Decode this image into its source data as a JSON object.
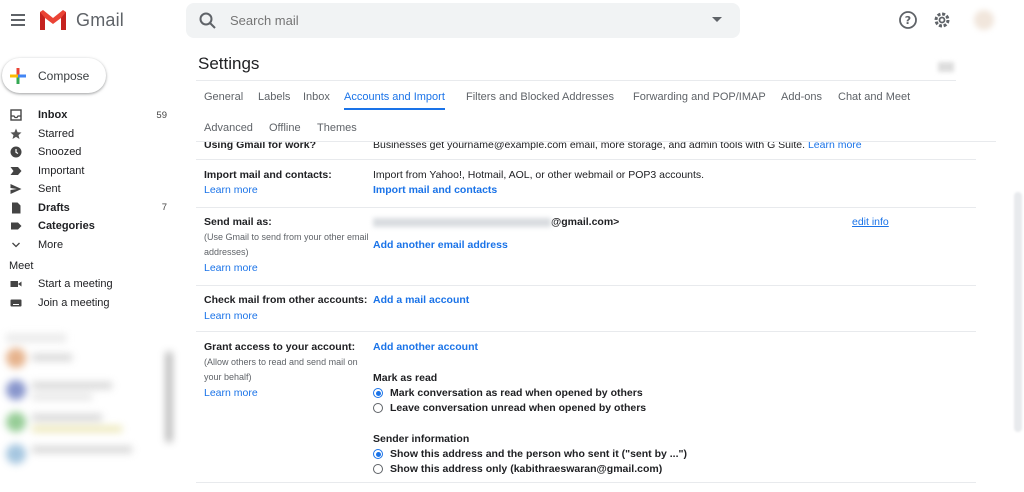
{
  "app": {
    "name": "Gmail"
  },
  "search": {
    "placeholder": "Search mail"
  },
  "sidebar": {
    "compose_label": "Compose",
    "items": [
      {
        "label": "Inbox",
        "count": "59",
        "bold": true,
        "icon": "inbox-icon"
      },
      {
        "label": "Starred",
        "count": "",
        "bold": false,
        "icon": "star-icon"
      },
      {
        "label": "Snoozed",
        "count": "",
        "bold": false,
        "icon": "clock-icon"
      },
      {
        "label": "Important",
        "count": "",
        "bold": false,
        "icon": "label-important-icon"
      },
      {
        "label": "Sent",
        "count": "",
        "bold": false,
        "icon": "send-icon"
      },
      {
        "label": "Drafts",
        "count": "7",
        "bold": true,
        "icon": "draft-icon"
      },
      {
        "label": "Categories",
        "count": "",
        "bold": true,
        "icon": "label-icon"
      },
      {
        "label": "More",
        "count": "",
        "bold": false,
        "icon": "chevron-down-icon"
      }
    ],
    "meet": {
      "title": "Meet",
      "items": [
        {
          "label": "Start a meeting",
          "icon": "videocam-icon"
        },
        {
          "label": "Join a meeting",
          "icon": "keyboard-icon"
        }
      ]
    }
  },
  "settings": {
    "title": "Settings",
    "tabs": [
      {
        "label": "General"
      },
      {
        "label": "Labels"
      },
      {
        "label": "Inbox"
      },
      {
        "label": "Accounts and Import",
        "active": true
      },
      {
        "label": "Filters and Blocked Addresses"
      },
      {
        "label": "Forwarding and POP/IMAP"
      },
      {
        "label": "Add-ons"
      },
      {
        "label": "Chat and Meet"
      },
      {
        "label": "Advanced"
      },
      {
        "label": "Offline"
      },
      {
        "label": "Themes"
      }
    ],
    "sections": {
      "gsuite": {
        "label": "Using Gmail for work?",
        "text": "Businesses get yourname@example.com email, more storage, and admin tools with G Suite.",
        "link": "Learn more"
      },
      "import": {
        "label": "Import mail and contacts:",
        "learn_more": "Learn more",
        "text": "Import from Yahoo!, Hotmail, AOL, or other webmail or POP3 accounts.",
        "action": "Import mail and contacts"
      },
      "send_as": {
        "label": "Send mail as:",
        "sub": "(Use Gmail to send from your other email addresses)",
        "learn_more": "Learn more",
        "address_suffix": "@gmail.com>",
        "edit": "edit info",
        "action": "Add another email address"
      },
      "check_mail": {
        "label": "Check mail from other accounts:",
        "learn_more": "Learn more",
        "action": "Add a mail account"
      },
      "grant": {
        "label": "Grant access to your account:",
        "sub": "(Allow others to read and send mail on your behalf)",
        "learn_more": "Learn more",
        "action": "Add another account",
        "mark_title": "Mark as read",
        "mark_options": [
          {
            "label": "Mark conversation as read when opened by others",
            "checked": true
          },
          {
            "label": "Leave conversation unread when opened by others",
            "checked": false
          }
        ],
        "sender_title": "Sender information",
        "sender_options": [
          {
            "label": "Show this address and the person who sent it (\"sent by ...\")",
            "checked": true
          },
          {
            "label": "Show this address only (kabithraeswaran@gmail.com)",
            "checked": false
          }
        ]
      }
    }
  },
  "colors": {
    "accent": "#1a73e8",
    "gmail_red": "#ea4335",
    "text": "#202124",
    "muted": "#5f6368"
  }
}
